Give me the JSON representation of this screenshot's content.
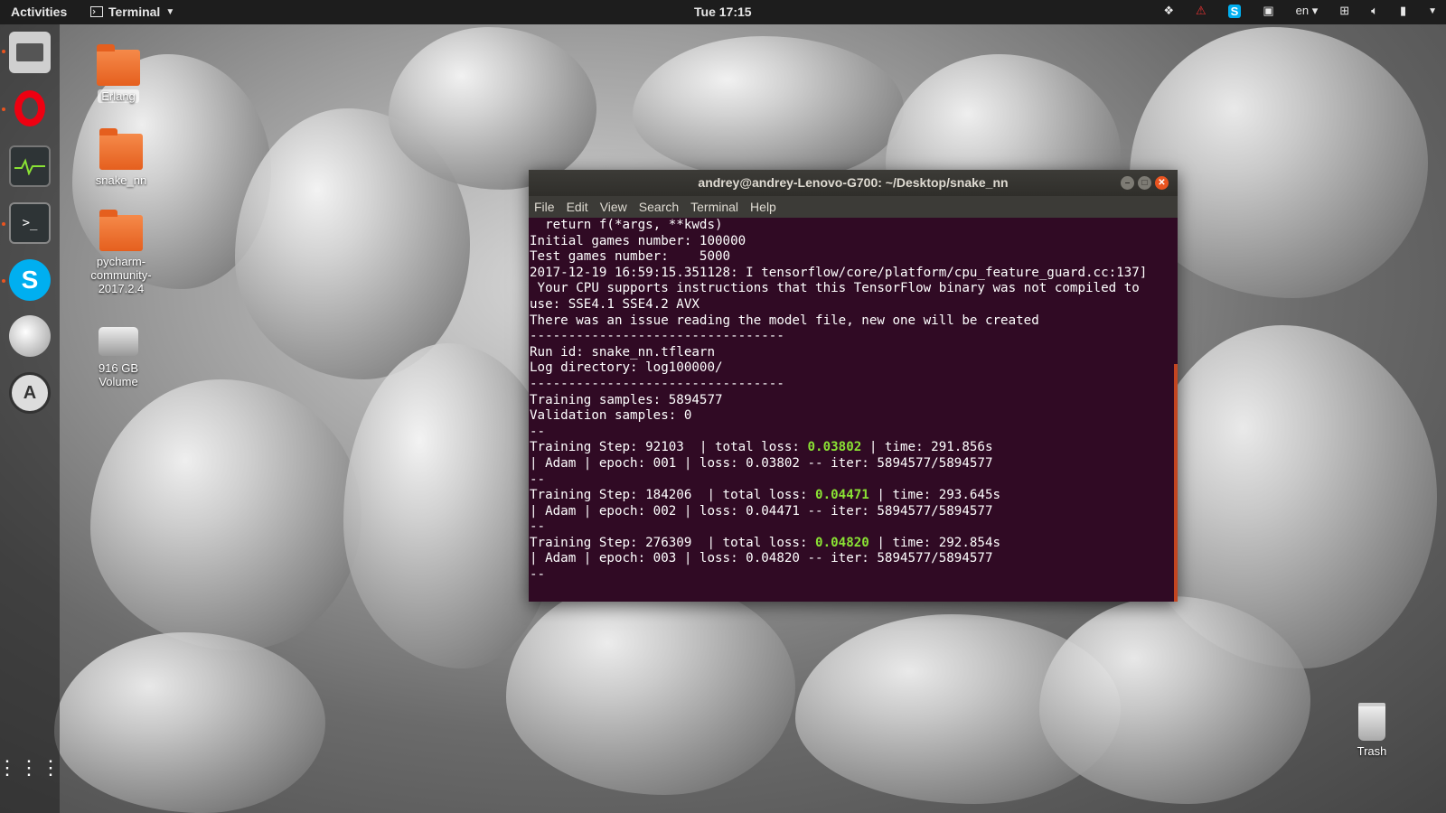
{
  "topbar": {
    "activities": "Activities",
    "app_menu": "Terminal",
    "clock": "Tue 17:15",
    "lang": "en"
  },
  "dock": {
    "icons": [
      "files-icon",
      "opera-icon",
      "system-monitor-icon",
      "terminal-icon",
      "skype-icon",
      "disk-icon",
      "software-updater-icon",
      "show-apps-icon"
    ]
  },
  "desktop": {
    "items": [
      {
        "label": "Erlang"
      },
      {
        "label": "snake_nn"
      },
      {
        "label": "pycharm-community-2017.2.4"
      },
      {
        "label": "916 GB Volume"
      }
    ],
    "trash_label": "Trash"
  },
  "terminal": {
    "title": "andrey@andrey-Lenovo-G700: ~/Desktop/snake_nn",
    "menu": [
      "File",
      "Edit",
      "View",
      "Search",
      "Terminal",
      "Help"
    ],
    "lines": [
      "  return f(*args, **kwds)",
      "Initial games number: 100000",
      "Test games number:    5000",
      "2017-12-19 16:59:15.351128: I tensorflow/core/platform/cpu_feature_guard.cc:137]",
      " Your CPU supports instructions that this TensorFlow binary was not compiled to",
      "use: SSE4.1 SSE4.2 AVX",
      "There was an issue reading the model file, new one will be created",
      "---------------------------------",
      "Run id: snake_nn.tflearn",
      "Log directory: log100000/",
      "---------------------------------",
      "Training samples: 5894577",
      "Validation samples: 0",
      "--"
    ],
    "steps": [
      {
        "prefix": "Training Step: 92103  | total loss: ",
        "loss": "0.03802",
        "suffix": " | time: 291.856s",
        "detail": "| Adam | epoch: 001 | loss: 0.03802 -- iter: 5894577/5894577"
      },
      {
        "prefix": "Training Step: 184206  | total loss: ",
        "loss": "0.04471",
        "suffix": " | time: 293.645s",
        "detail": "| Adam | epoch: 002 | loss: 0.04471 -- iter: 5894577/5894577"
      },
      {
        "prefix": "Training Step: 276309  | total loss: ",
        "loss": "0.04820",
        "suffix": " | time: 292.854s",
        "detail": "| Adam | epoch: 003 | loss: 0.04820 -- iter: 5894577/5894577"
      }
    ],
    "sep": "--",
    "loss_color": "#8ae234"
  }
}
